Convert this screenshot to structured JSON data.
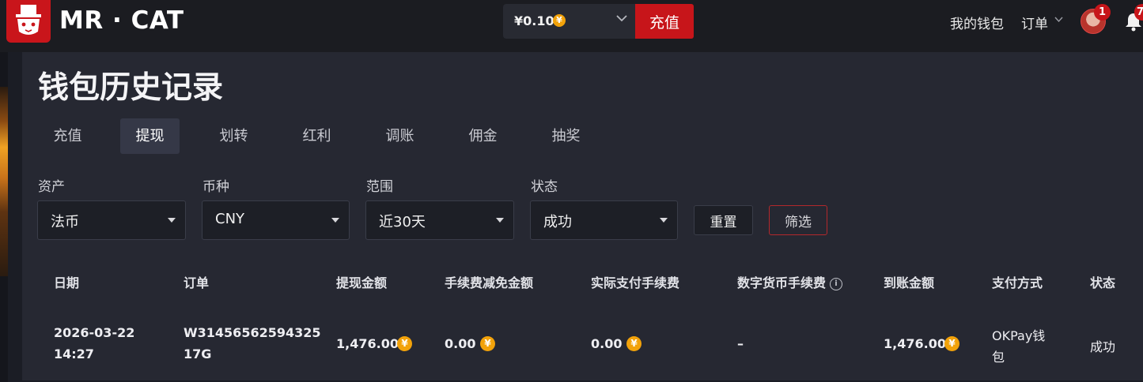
{
  "header": {
    "brand": "MR · CAT",
    "balance": "¥0.10",
    "coin_symbol": "¥",
    "deposit_label": "充值",
    "my_wallet_label": "我的钱包",
    "orders_label": "订单",
    "avatar_badge_count": "1",
    "bell_badge_count": "7"
  },
  "page": {
    "title": "钱包历史记录"
  },
  "tabs": [
    {
      "label": "充值",
      "active": false
    },
    {
      "label": "提现",
      "active": true
    },
    {
      "label": "划转",
      "active": false
    },
    {
      "label": "红利",
      "active": false
    },
    {
      "label": "调账",
      "active": false
    },
    {
      "label": "佣金",
      "active": false
    },
    {
      "label": "抽奖",
      "active": false
    }
  ],
  "filters": {
    "asset": {
      "label": "资产",
      "value": "法币"
    },
    "currency": {
      "label": "币种",
      "value": "CNY"
    },
    "range": {
      "label": "范围",
      "value": "近30天"
    },
    "status": {
      "label": "状态",
      "value": "成功"
    },
    "reset_label": "重置",
    "filter_label": "筛选"
  },
  "table": {
    "columns": [
      "日期",
      "订单",
      "提现金额",
      "手续费减免金额",
      "实际支付手续费",
      "数字货币手续费",
      "到账金额",
      "支付方式",
      "状态"
    ],
    "rows": [
      {
        "date": "2026-03-22",
        "time": "14:27",
        "order_line1": "W31456562594325",
        "order_line2": "17G",
        "withdraw_amount": "1,476.00",
        "fee_discount": "0.00",
        "actual_fee": "0.00",
        "crypto_fee": "–",
        "received_amount": "1,476.00",
        "payment_method_line1": "OKPay钱",
        "payment_method_line2": "包",
        "status": "成功"
      }
    ]
  },
  "colors": {
    "accent_red": "#c7151a",
    "coin_gold": "#f2a20a",
    "panel_bg": "#262832",
    "page_bg": "#1b1d25"
  }
}
